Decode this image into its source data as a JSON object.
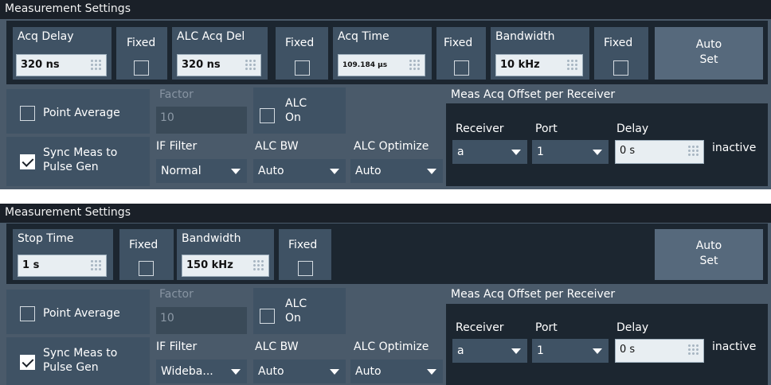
{
  "panel1": {
    "title": "Measurement Settings",
    "acq_delay": {
      "label": "Acq Delay",
      "value": "320 ns"
    },
    "fixed1": {
      "label": "Fixed",
      "checked": false
    },
    "alc_acq_del": {
      "label": "ALC Acq Del",
      "value": "320 ns"
    },
    "fixed2": {
      "label": "Fixed",
      "checked": false
    },
    "acq_time": {
      "label": "Acq Time",
      "value": "109.184 µs"
    },
    "fixed3": {
      "label": "Fixed",
      "checked": false
    },
    "bandwidth": {
      "label": "Bandwidth",
      "value": "10 kHz"
    },
    "fixed4": {
      "label": "Fixed",
      "checked": false
    },
    "auto_set": {
      "line1": "Auto",
      "line2": "Set"
    },
    "point_average": {
      "label": "Point Average",
      "checked": false
    },
    "factor": {
      "label": "Factor",
      "value": "10"
    },
    "alc_on": {
      "line1": "ALC",
      "line2": "On",
      "checked": false
    },
    "sync_meas": {
      "line1": "Sync Meas to",
      "line2": "Pulse Gen",
      "checked": true
    },
    "if_filter": {
      "label": "IF Filter",
      "value": "Normal"
    },
    "alc_bw": {
      "label": "ALC BW",
      "value": "Auto"
    },
    "alc_optimize": {
      "label": "ALC Optimize",
      "value": "Auto"
    },
    "meas_acq_offset": {
      "title": "Meas Acq Offset per Receiver",
      "receiver": {
        "label": "Receiver",
        "value": "a"
      },
      "port": {
        "label": "Port",
        "value": "1"
      },
      "delay": {
        "label": "Delay",
        "value": "0 s"
      },
      "status": "inactive"
    }
  },
  "panel2": {
    "title": "Measurement Settings",
    "stop_time": {
      "label": "Stop Time",
      "value": "1 s"
    },
    "fixed1": {
      "label": "Fixed",
      "checked": false
    },
    "bandwidth": {
      "label": "Bandwidth",
      "value": "150 kHz"
    },
    "fixed2": {
      "label": "Fixed",
      "checked": false
    },
    "auto_set": {
      "line1": "Auto",
      "line2": "Set"
    },
    "point_average": {
      "label": "Point Average",
      "checked": false
    },
    "factor": {
      "label": "Factor",
      "value": "10"
    },
    "alc_on": {
      "line1": "ALC",
      "line2": "On",
      "checked": false
    },
    "sync_meas": {
      "line1": "Sync Meas to",
      "line2": "Pulse Gen",
      "checked": true
    },
    "if_filter": {
      "label": "IF Filter",
      "value": "Wideba..."
    },
    "alc_bw": {
      "label": "ALC BW",
      "value": "Auto"
    },
    "alc_optimize": {
      "label": "ALC Optimize",
      "value": "Auto"
    },
    "meas_acq_offset": {
      "title": "Meas Acq Offset per Receiver",
      "receiver": {
        "label": "Receiver",
        "value": "a"
      },
      "port": {
        "label": "Port",
        "value": "1"
      },
      "delay": {
        "label": "Delay",
        "value": "0 s"
      },
      "status": "inactive"
    }
  }
}
